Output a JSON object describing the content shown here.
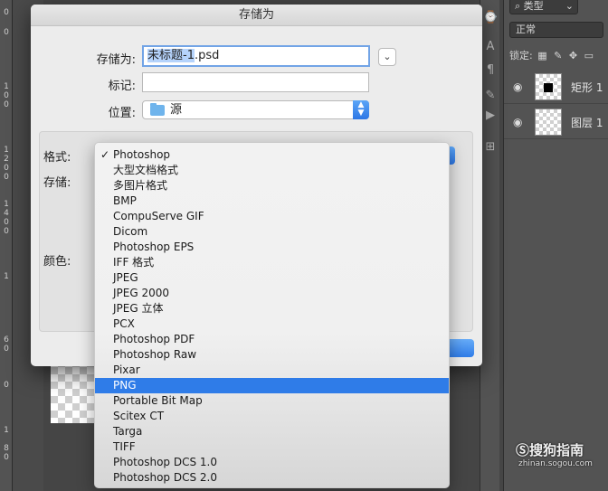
{
  "dialog": {
    "title": "存储为",
    "save_as_label": "存储为:",
    "file_name_selected": "未标题-1",
    "file_name_rest": ".psd",
    "tags_label": "标记:",
    "tags_value": "",
    "location_label": "位置:",
    "location_value": "源",
    "format_label": "格式:",
    "store_label": "存储:",
    "color_label": "颜色:"
  },
  "format_menu": {
    "checked_index": 0,
    "selected_index": 15,
    "items": [
      "Photoshop",
      "大型文档格式",
      "多图片格式",
      "BMP",
      "CompuServe GIF",
      "Dicom",
      "Photoshop EPS",
      "IFF 格式",
      "JPEG",
      "JPEG 2000",
      "JPEG 立体",
      "PCX",
      "Photoshop PDF",
      "Photoshop Raw",
      "Pixar",
      "PNG",
      "Portable Bit Map",
      "Scitex CT",
      "Targa",
      "TIFF",
      "Photoshop DCS 1.0",
      "Photoshop DCS 2.0"
    ]
  },
  "layers_panel": {
    "filter_label": "类型",
    "blend_mode": "正常",
    "lock_label": "锁定:",
    "layers": [
      {
        "name": "矩形 1"
      },
      {
        "name": "图层 1"
      }
    ]
  },
  "ruler_ticks": [
    "0",
    "0",
    "1",
    "0",
    "0",
    "1",
    "2",
    "0",
    "0",
    "1",
    "4",
    "0",
    "0",
    "1",
    "6",
    "0",
    "0",
    "1",
    "8",
    "0"
  ],
  "watermark": {
    "logo": "搜狗指南",
    "url": "zhinan.sogou.com"
  },
  "colors": {
    "accent": "#2f7ce8",
    "selection_text": "#b5d3fb"
  }
}
